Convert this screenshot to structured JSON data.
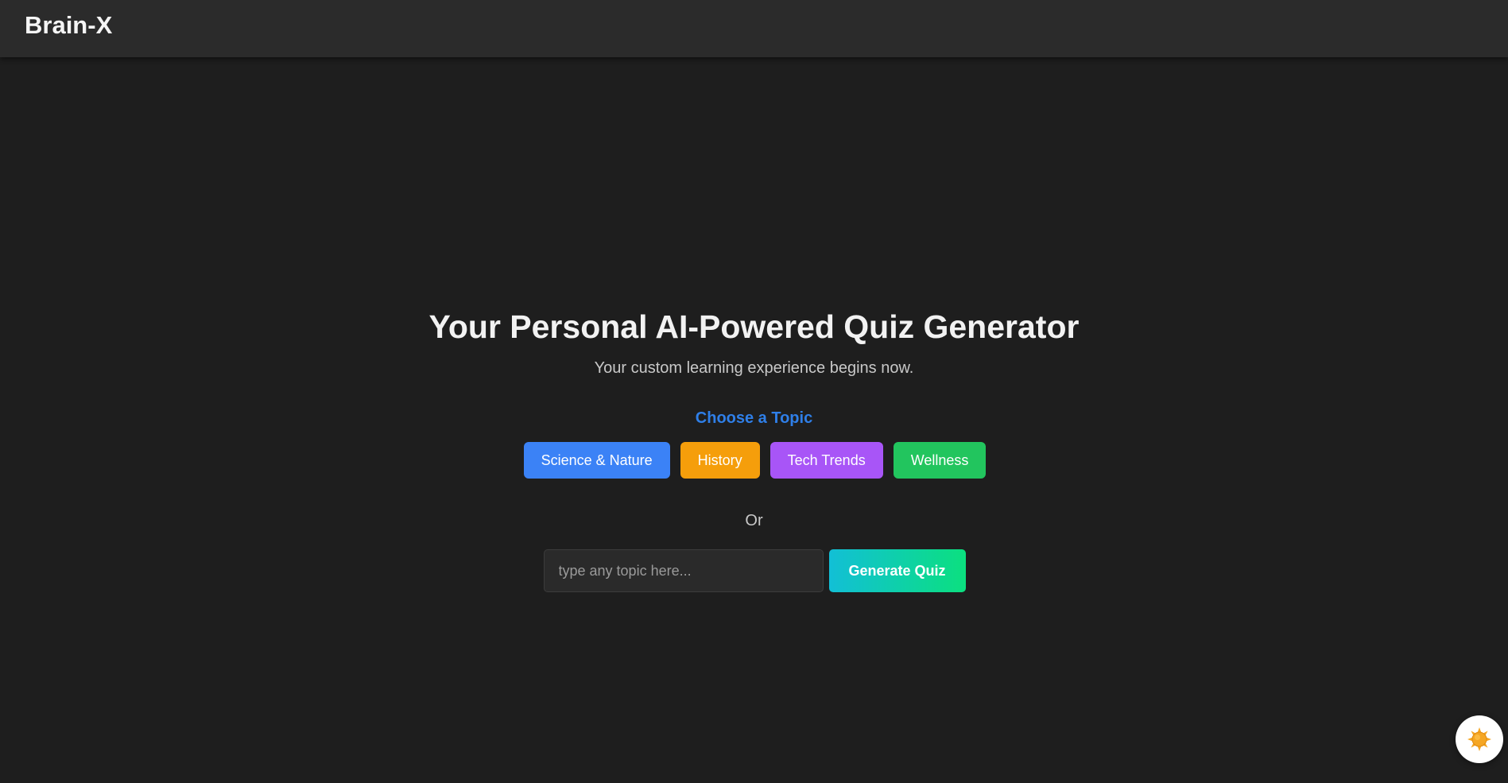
{
  "header": {
    "logo": "Brain-X"
  },
  "hero": {
    "title": "Your Personal AI-Powered Quiz Generator",
    "subtitle": "Your custom learning experience begins now."
  },
  "topics": {
    "heading": "Choose a Topic",
    "items": [
      {
        "label": "Science & Nature",
        "color": "#3b82f6"
      },
      {
        "label": "History",
        "color": "#f59e0b"
      },
      {
        "label": "Tech Trends",
        "color": "#a855f7"
      },
      {
        "label": "Wellness",
        "color": "#22c55e"
      }
    ]
  },
  "divider": {
    "label": "Or"
  },
  "custom_topic": {
    "value": "",
    "placeholder": "type any topic here...",
    "button_label": "Generate Quiz"
  },
  "theme_toggle": {
    "icon": "sun-icon"
  },
  "colors": {
    "background": "#1e1e1e",
    "header": "#2b2b2b",
    "accent": "#2f7fe8",
    "generate_gradient_start": "#12bfd6",
    "generate_gradient_end": "#0be07f",
    "sun": "#f5a623"
  }
}
